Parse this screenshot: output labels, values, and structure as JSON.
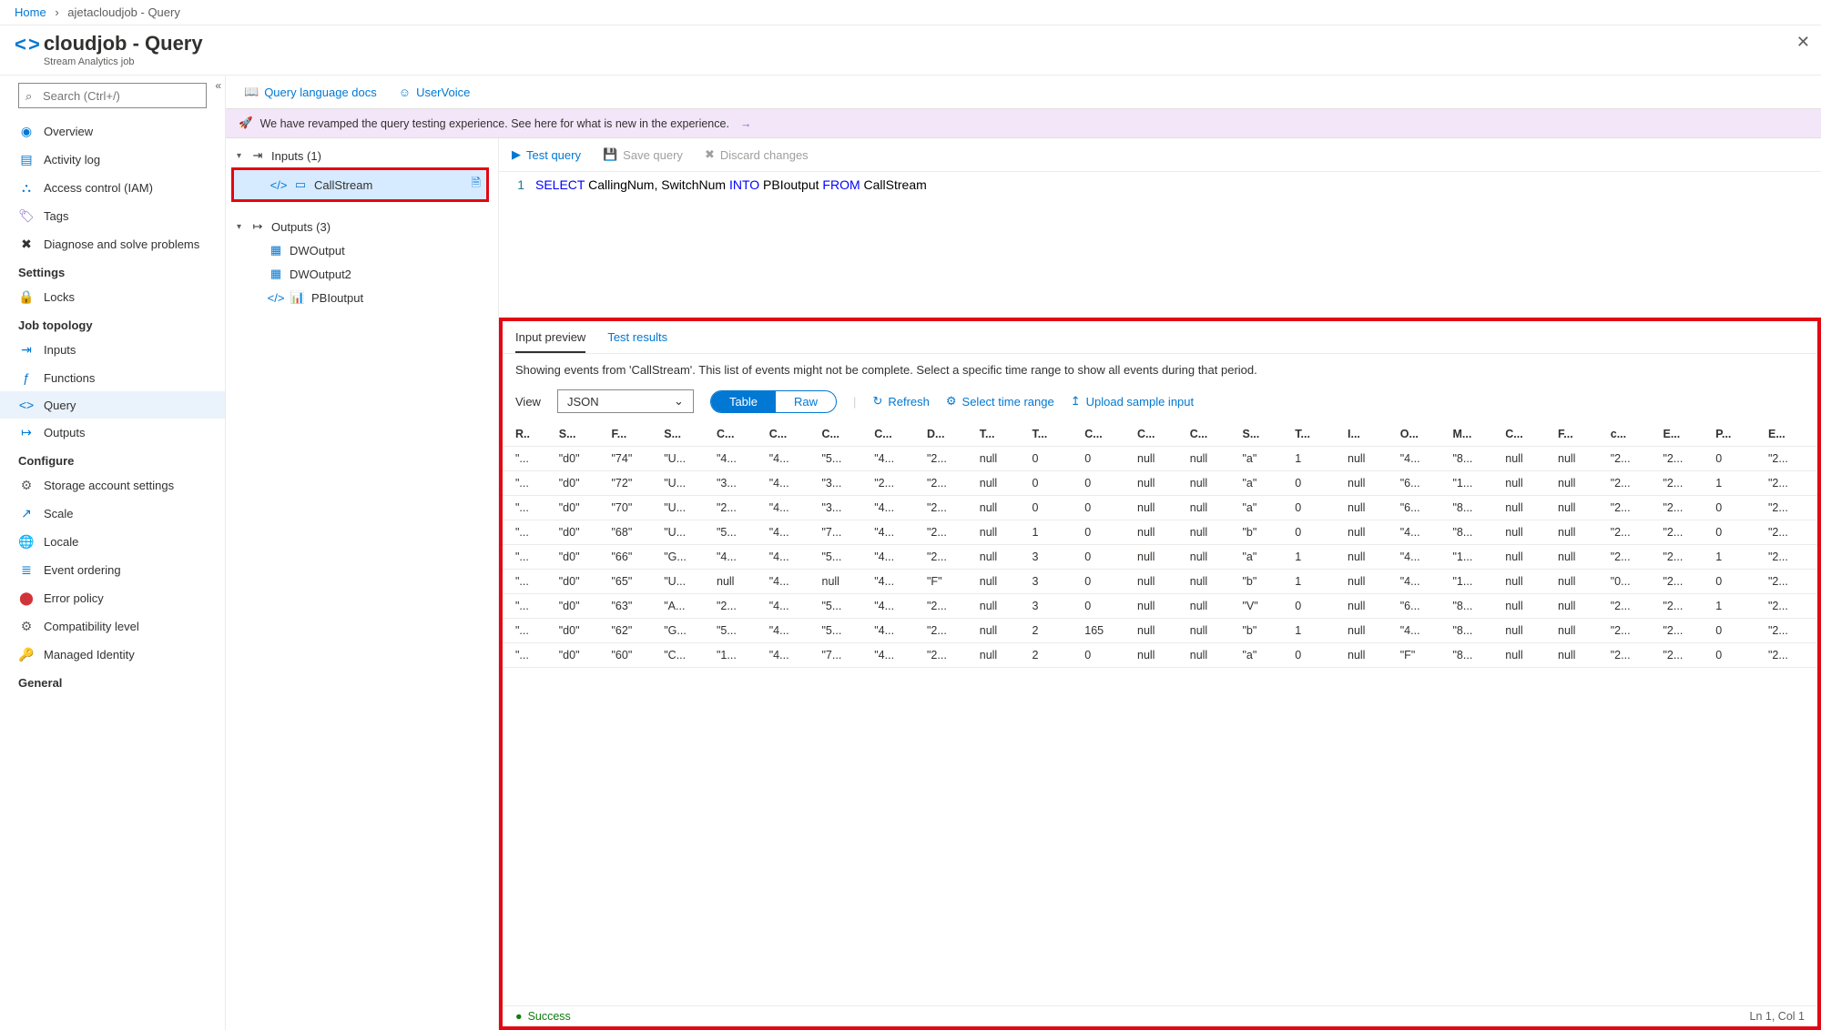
{
  "breadcrumb": {
    "home": "Home",
    "current": "ajetacloudjob - Query"
  },
  "header": {
    "title": "cloudjob - Query",
    "subtitle": "Stream Analytics job"
  },
  "search": {
    "placeholder": "Search (Ctrl+/)"
  },
  "nav": {
    "top": [
      {
        "label": "Overview",
        "icon": "◉",
        "cls": "c-blue"
      },
      {
        "label": "Activity log",
        "icon": "▤",
        "cls": "c-blue"
      },
      {
        "label": "Access control (IAM)",
        "icon": "⛬",
        "cls": "c-blue"
      },
      {
        "label": "Tags",
        "icon": "🏷",
        "cls": "c-purple"
      },
      {
        "label": "Diagnose and solve problems",
        "icon": "✖",
        "cls": ""
      }
    ],
    "groups": [
      {
        "title": "Settings",
        "items": [
          {
            "label": "Locks",
            "icon": "🔒",
            "cls": ""
          }
        ]
      },
      {
        "title": "Job topology",
        "items": [
          {
            "label": "Inputs",
            "icon": "⇥",
            "cls": "c-blue"
          },
          {
            "label": "Functions",
            "icon": "ƒ",
            "cls": "c-blue"
          },
          {
            "label": "Query",
            "icon": "<>",
            "cls": "c-blue",
            "active": true
          },
          {
            "label": "Outputs",
            "icon": "↦",
            "cls": "c-blue"
          }
        ]
      },
      {
        "title": "Configure",
        "items": [
          {
            "label": "Storage account settings",
            "icon": "⚙",
            "cls": "c-gray"
          },
          {
            "label": "Scale",
            "icon": "↗",
            "cls": "c-blue"
          },
          {
            "label": "Locale",
            "icon": "🌐",
            "cls": "c-green"
          },
          {
            "label": "Event ordering",
            "icon": "≣",
            "cls": "c-blue"
          },
          {
            "label": "Error policy",
            "icon": "⬤",
            "cls": "c-red"
          },
          {
            "label": "Compatibility level",
            "icon": "⚙",
            "cls": "c-gray"
          },
          {
            "label": "Managed Identity",
            "icon": "🔑",
            "cls": "c-yellow"
          }
        ]
      },
      {
        "title": "General",
        "items": []
      }
    ]
  },
  "toolbar": {
    "docs": "Query language docs",
    "uservoice": "UserVoice"
  },
  "banner": {
    "text": "We have revamped the query testing experience. See here for what is new in the experience."
  },
  "tree": {
    "inputs_label": "Inputs (1)",
    "inputs": [
      {
        "label": "CallStream",
        "selected": true
      }
    ],
    "outputs_label": "Outputs (3)",
    "outputs": [
      {
        "label": "DWOutput",
        "icon": "sql"
      },
      {
        "label": "DWOutput2",
        "icon": "sql"
      },
      {
        "label": "PBIoutput",
        "icon": "pbi"
      }
    ]
  },
  "query_toolbar": {
    "test": "Test query",
    "save": "Save query",
    "discard": "Discard changes"
  },
  "query": {
    "line_no": "1",
    "tokens": [
      {
        "t": "SELECT",
        "k": true
      },
      {
        "t": " CallingNum, SwitchNum ",
        "k": false
      },
      {
        "t": "INTO",
        "k": true
      },
      {
        "t": " PBIoutput ",
        "k": false
      },
      {
        "t": "FROM",
        "k": true
      },
      {
        "t": " CallStream",
        "k": false
      }
    ]
  },
  "preview": {
    "tabs": {
      "input": "Input preview",
      "results": "Test results"
    },
    "info": "Showing events from 'CallStream'. This list of events might not be complete. Select a specific time range to show all events during that period.",
    "view_label": "View",
    "view_value": "JSON",
    "toggle": {
      "table": "Table",
      "raw": "Raw"
    },
    "refresh": "Refresh",
    "select_range": "Select time range",
    "upload": "Upload sample input",
    "headers": [
      "R..",
      "S...",
      "F...",
      "S...",
      "C...",
      "C...",
      "C...",
      "C...",
      "D...",
      "T...",
      "T...",
      "C...",
      "C...",
      "C...",
      "S...",
      "T...",
      "I...",
      "O...",
      "M...",
      "C...",
      "F...",
      "c...",
      "E...",
      "P...",
      "E..."
    ],
    "rows": [
      [
        "\"...",
        "\"d0\"",
        "\"74\"",
        "\"U...",
        "\"4...",
        "\"4...",
        "\"5...",
        "\"4...",
        "\"2...",
        "null",
        "0",
        "0",
        "null",
        "null",
        "\"a\"",
        "1",
        "null",
        "\"4...",
        "\"8...",
        "null",
        "null",
        "\"2...",
        "\"2...",
        "0",
        "\"2..."
      ],
      [
        "\"...",
        "\"d0\"",
        "\"72\"",
        "\"U...",
        "\"3...",
        "\"4...",
        "\"3...",
        "\"2...",
        "\"2...",
        "null",
        "0",
        "0",
        "null",
        "null",
        "\"a\"",
        "0",
        "null",
        "\"6...",
        "\"1...",
        "null",
        "null",
        "\"2...",
        "\"2...",
        "1",
        "\"2..."
      ],
      [
        "\"...",
        "\"d0\"",
        "\"70\"",
        "\"U...",
        "\"2...",
        "\"4...",
        "\"3...",
        "\"4...",
        "\"2...",
        "null",
        "0",
        "0",
        "null",
        "null",
        "\"a\"",
        "0",
        "null",
        "\"6...",
        "\"8...",
        "null",
        "null",
        "\"2...",
        "\"2...",
        "0",
        "\"2..."
      ],
      [
        "\"...",
        "\"d0\"",
        "\"68\"",
        "\"U...",
        "\"5...",
        "\"4...",
        "\"7...",
        "\"4...",
        "\"2...",
        "null",
        "1",
        "0",
        "null",
        "null",
        "\"b\"",
        "0",
        "null",
        "\"4...",
        "\"8...",
        "null",
        "null",
        "\"2...",
        "\"2...",
        "0",
        "\"2..."
      ],
      [
        "\"...",
        "\"d0\"",
        "\"66\"",
        "\"G...",
        "\"4...",
        "\"4...",
        "\"5...",
        "\"4...",
        "\"2...",
        "null",
        "3",
        "0",
        "null",
        "null",
        "\"a\"",
        "1",
        "null",
        "\"4...",
        "\"1...",
        "null",
        "null",
        "\"2...",
        "\"2...",
        "1",
        "\"2..."
      ],
      [
        "\"...",
        "\"d0\"",
        "\"65\"",
        "\"U...",
        "null",
        "\"4...",
        "null",
        "\"4...",
        "\"F\"",
        "null",
        "3",
        "0",
        "null",
        "null",
        "\"b\"",
        "1",
        "null",
        "\"4...",
        "\"1...",
        "null",
        "null",
        "\"0...",
        "\"2...",
        "0",
        "\"2..."
      ],
      [
        "\"...",
        "\"d0\"",
        "\"63\"",
        "\"A...",
        "\"2...",
        "\"4...",
        "\"5...",
        "\"4...",
        "\"2...",
        "null",
        "3",
        "0",
        "null",
        "null",
        "\"V\"",
        "0",
        "null",
        "\"6...",
        "\"8...",
        "null",
        "null",
        "\"2...",
        "\"2...",
        "1",
        "\"2..."
      ],
      [
        "\"...",
        "\"d0\"",
        "\"62\"",
        "\"G...",
        "\"5...",
        "\"4...",
        "\"5...",
        "\"4...",
        "\"2...",
        "null",
        "2",
        "165",
        "null",
        "null",
        "\"b\"",
        "1",
        "null",
        "\"4...",
        "\"8...",
        "null",
        "null",
        "\"2...",
        "\"2...",
        "0",
        "\"2..."
      ],
      [
        "\"...",
        "\"d0\"",
        "\"60\"",
        "\"C...",
        "\"1...",
        "\"4...",
        "\"7...",
        "\"4...",
        "\"2...",
        "null",
        "2",
        "0",
        "null",
        "null",
        "\"a\"",
        "0",
        "null",
        "\"F\"",
        "\"8...",
        "null",
        "null",
        "\"2...",
        "\"2...",
        "0",
        "\"2..."
      ]
    ],
    "status": "Success",
    "cursor": "Ln 1, Col 1"
  }
}
